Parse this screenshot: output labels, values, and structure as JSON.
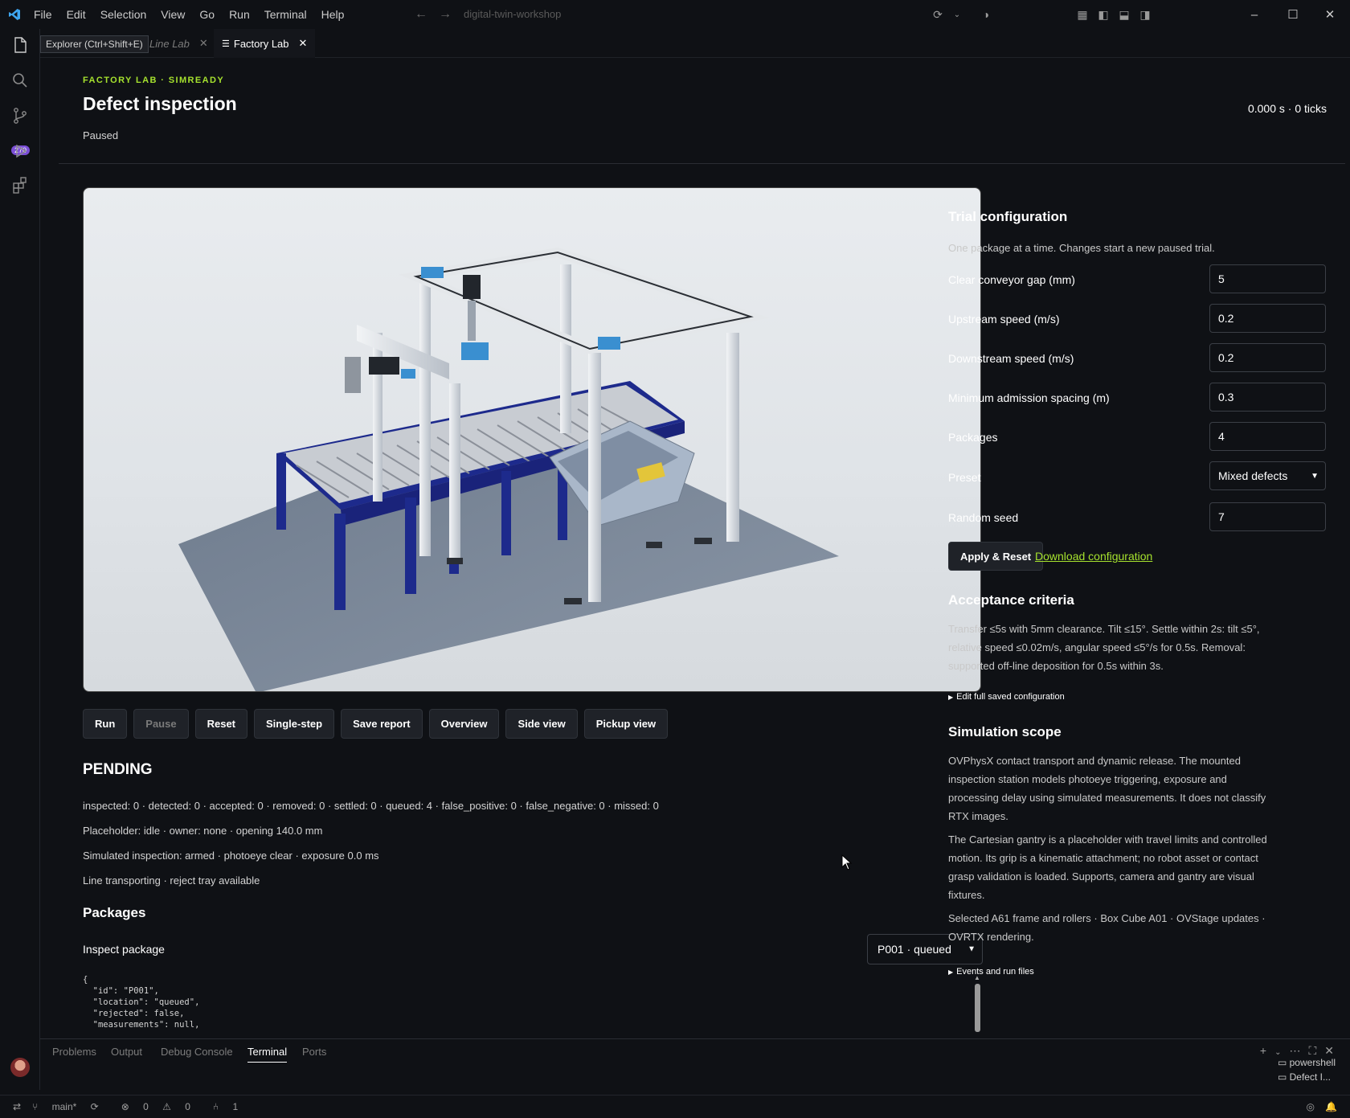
{
  "titlebar": {
    "menu": [
      "File",
      "Edit",
      "Selection",
      "View",
      "Go",
      "Run",
      "Terminal",
      "Help"
    ],
    "command_center": "digital-twin-workshop"
  },
  "activity": {
    "source_control_badge": "270"
  },
  "tabs": {
    "inactive_label": "Line Lab",
    "active_label": "Factory Lab",
    "tooltip": "Explorer (Ctrl+Shift+E)"
  },
  "header": {
    "eyebrow": "FACTORY LAB · SIMREADY",
    "title": "Defect inspection",
    "status": "Paused",
    "clock": "0.000 s · 0 ticks"
  },
  "controls": {
    "run": "Run",
    "pause": "Pause",
    "reset": "Reset",
    "single_step": "Single-step",
    "save_report": "Save report",
    "overview": "Overview",
    "side_view": "Side view",
    "pickup_view": "Pickup view"
  },
  "summary": {
    "state": "PENDING",
    "counts": "inspected: 0 · detected: 0 · accepted: 0 · removed: 0 · settled: 0 · queued: 4 · false_positive: 0 · false_negative: 0 · missed: 0",
    "placeholder": "Placeholder: idle · owner: none · opening 140.0 mm",
    "inspection": "Simulated inspection: armed · photoeye clear · exposure 0.0 ms",
    "line": "Line transporting · reject tray available"
  },
  "packages": {
    "title": "Packages",
    "inspect_label": "Inspect package",
    "selected": "P001 · queued",
    "json_lines": [
      "{",
      "  \"id\": \"P001\",",
      "  \"location\": \"queued\",",
      "  \"rejected\": false,",
      "  \"measurements\": null,"
    ]
  },
  "trial": {
    "title": "Trial configuration",
    "description": "One package at a time. Changes start a new paused trial.",
    "fields": [
      {
        "label": "Clear conveyor gap (mm)",
        "value": "5"
      },
      {
        "label": "Upstream speed (m/s)",
        "value": "0.2"
      },
      {
        "label": "Downstream speed (m/s)",
        "value": "0.2"
      },
      {
        "label": "Minimum admission spacing (m)",
        "value": "0.3"
      },
      {
        "label": "Packages",
        "value": "4"
      },
      {
        "label": "Preset",
        "value": "Mixed defects"
      },
      {
        "label": "Random seed",
        "value": "7"
      }
    ],
    "apply": "Apply & Reset",
    "download": "Download configuration"
  },
  "acceptance": {
    "title": "Acceptance criteria",
    "text": "Transfer ≤5s with 5mm clearance. Tilt ≤15°. Settle within 2s: tilt ≤5°, relative speed ≤0.02m/s, angular speed ≤5°/s for 0.5s. Removal: supported off-line deposition for 0.5s within 3s.",
    "details": "Edit full saved configuration"
  },
  "scope": {
    "title": "Simulation scope",
    "p1": "OVPhysX contact transport and dynamic release. The mounted inspection station models photoeye triggering, exposure and processing delay using simulated measurements. It does not classify RTX images.",
    "p2": "The Cartesian gantry is a placeholder with travel limits and controlled motion. Its grip is a kinematic attachment; no robot asset or contact grasp validation is loaded. Supports, camera and gantry are visual fixtures.",
    "p3": "Selected A61 frame and rollers · Box Cube A01 · OVStage updates · OVRTX rendering.",
    "details": "Events and run files"
  },
  "panel": {
    "tabs": [
      "Problems",
      "Output",
      "Debug Console",
      "Terminal",
      "Ports"
    ],
    "active_tab": "Terminal",
    "terminals": [
      "powershell",
      "Defect I..."
    ]
  },
  "statusbar": {
    "branch": "main*",
    "errors": "0",
    "warnings": "0",
    "ports": "1"
  },
  "colors": {
    "accent": "#a6e22e",
    "background": "#0f1115",
    "badge": "#7b4fd6"
  }
}
